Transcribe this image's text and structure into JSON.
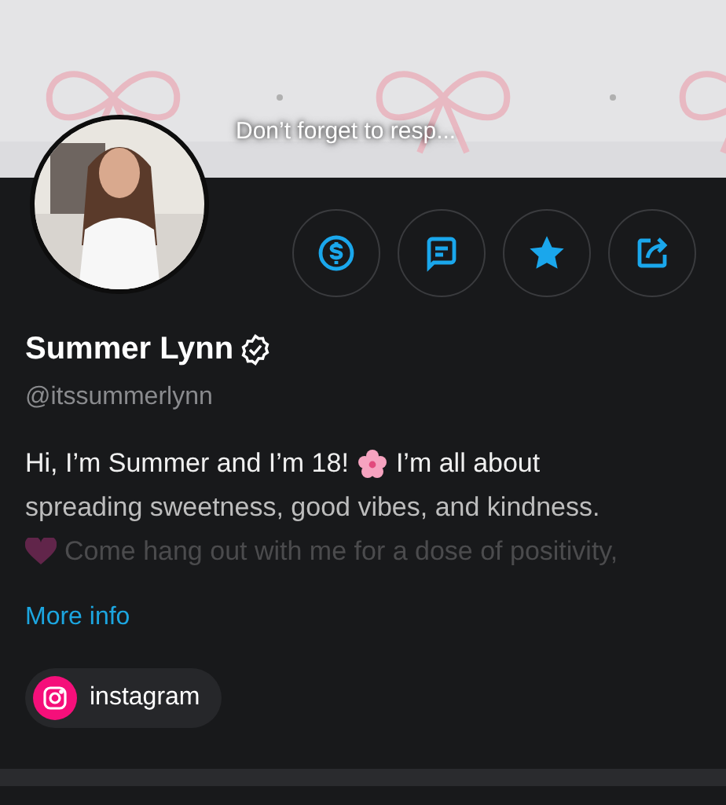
{
  "banner": {
    "kind": "picture",
    "caption": "Don’t forget to resp..."
  },
  "avatar": {
    "kind": "picture"
  },
  "actions": [
    {
      "kind": "tip"
    },
    {
      "kind": "message"
    },
    {
      "kind": "favorite"
    },
    {
      "kind": "share"
    }
  ],
  "profile": {
    "name": "Summer Lynn",
    "verified": true,
    "handle": "@itssummerlynn"
  },
  "bio": [
    [
      {
        "kind": "text",
        "text": "Hi, I’m Summer and I’m 18!"
      },
      {
        "kind": "flower"
      },
      {
        "kind": "text",
        "text": "I’m all about"
      }
    ],
    [
      {
        "kind": "text",
        "text": "spreading sweetness, good vibes, and kindness."
      }
    ],
    [
      {
        "kind": "heart"
      },
      {
        "kind": "text",
        "text": "Come hang out with me for a dose of positivity,"
      }
    ]
  ],
  "more_link": "More info",
  "socials": [
    {
      "kind": "instagram",
      "label": "instagram"
    }
  ]
}
